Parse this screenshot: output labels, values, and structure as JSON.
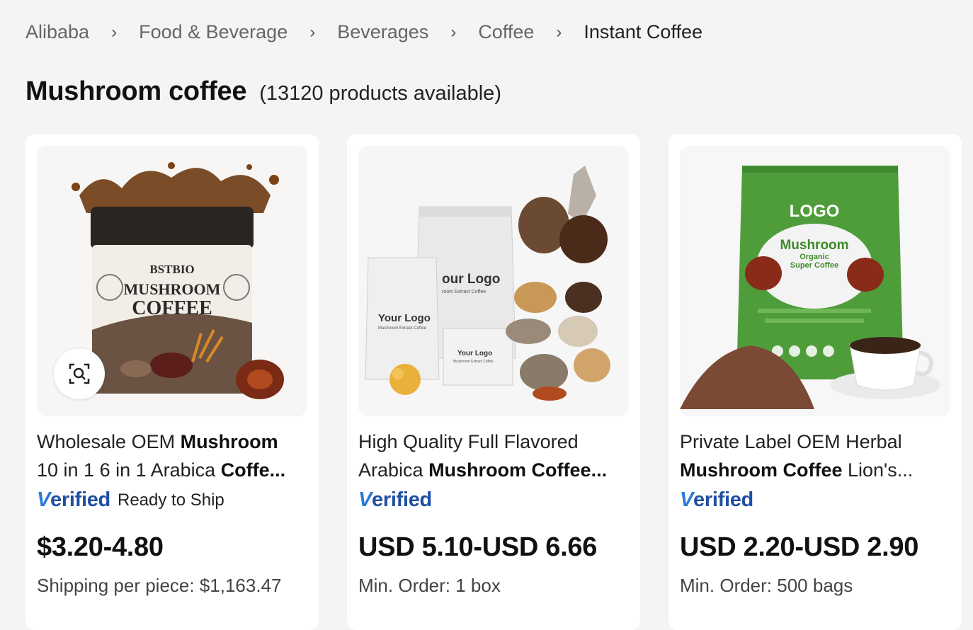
{
  "breadcrumb": {
    "items": [
      "Alibaba",
      "Food & Beverage",
      "Beverages",
      "Coffee",
      "Instant Coffee"
    ]
  },
  "header": {
    "title": "Mushroom coffee",
    "count": "(13120 products available)"
  },
  "verified_label": {
    "first": "V",
    "rest": "erified"
  },
  "colors": {
    "verified": "#1f4fa3",
    "background": "#f4f4f4",
    "card": "#ffffff"
  },
  "products": [
    {
      "title_line1": {
        "a": "Wholesale OEM ",
        "b": "Mushroom"
      },
      "title_line2": {
        "a": "10 in 1 6 in 1 Arabica ",
        "b": "Coffe..."
      },
      "ready_to_ship": "Ready to Ship",
      "price": "$3.20-4.80",
      "extra": "Shipping per piece: $1,163.47",
      "image": {
        "brand": "BSTBIO",
        "line1": "MUSHROOM",
        "line2": "COFFEE"
      }
    },
    {
      "title_line1": {
        "a": "High Quality Full Flavored",
        "b": ""
      },
      "title_line2": {
        "a": "Arabica ",
        "b": "Mushroom Coffee..."
      },
      "ready_to_ship": "",
      "price": "USD 5.10-USD 6.66",
      "extra": "Min. Order: 1 box",
      "image": {
        "big": "our Logo",
        "big_sub": "room Extract Coffee",
        "small": "Your Logo",
        "small_sub": "Mushroom Extract Coffee",
        "box": "Your Logo",
        "box_sub": "Mushroom Extract Coffee"
      }
    },
    {
      "title_line1": {
        "a": "Private Label OEM Herbal",
        "b": ""
      },
      "title_line2": {
        "a": "",
        "b": "Mushroom Coffee",
        "c": " Lion's..."
      },
      "ready_to_ship": "",
      "price": "USD 2.20-USD 2.90",
      "extra": "Min. Order: 500 bags",
      "image": {
        "logo": "LOGO",
        "arc": "Mushroom",
        "sub1": "Organic",
        "sub2": "Super Coffee"
      }
    }
  ]
}
